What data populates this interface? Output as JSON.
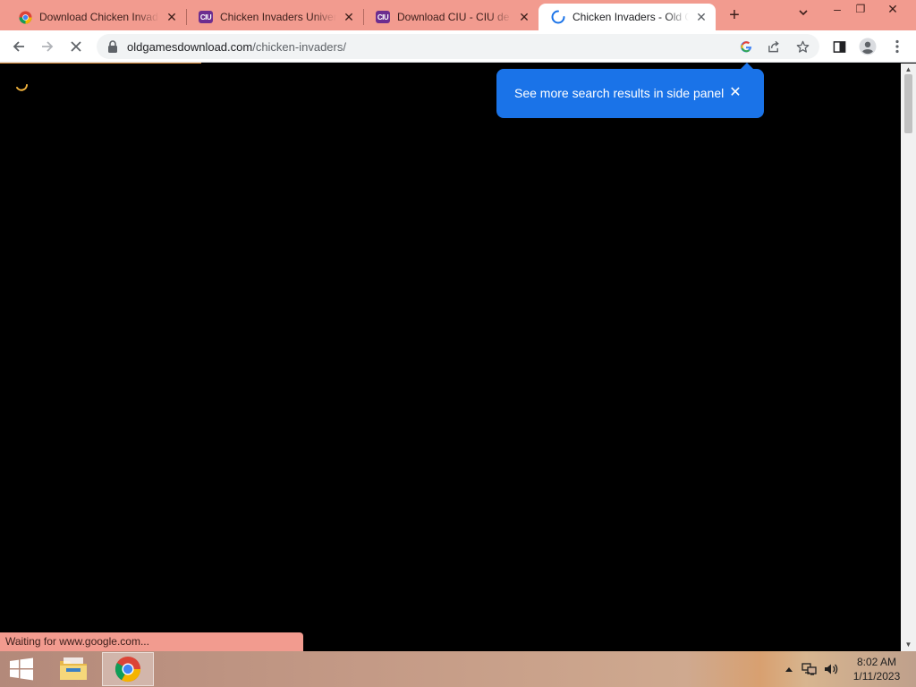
{
  "browser": {
    "tabs": [
      {
        "title": "Download Chicken Invaders",
        "favicon": "chrome-icon",
        "active": false
      },
      {
        "title": "Chicken Invaders Universe",
        "favicon": "ciu-icon",
        "active": false
      },
      {
        "title": "Download CIU - CIU de",
        "favicon": "ciu-icon",
        "active": false
      },
      {
        "title": "Chicken Invaders - Old G",
        "favicon": "loading-spinner-icon",
        "active": true
      }
    ],
    "tab_close_glyph": "✕",
    "new_tab_glyph": "+",
    "favicon_text": "CIU",
    "window_controls": {
      "minimize": "–",
      "restore": "❐",
      "close": "✕"
    },
    "address_bar": {
      "domain": "oldgamesdownload.com",
      "path": "/chicken-invaders/"
    },
    "load_progress_percent": 22,
    "colors": {
      "frame": "#f29b8f",
      "accent": "#1a73e8",
      "progress": "#f0a04b"
    }
  },
  "bubble": {
    "message": "See more search results in side panel",
    "close_glyph": "✕"
  },
  "status_bar": {
    "text": "Waiting for www.google.com..."
  },
  "taskbar": {
    "clock": {
      "time": "8:02 AM",
      "date": "1/11/2023"
    },
    "apps": [
      "file-explorer-icon",
      "chrome-icon"
    ],
    "tray": [
      "show-hidden-icons",
      "network-icon",
      "volume-icon"
    ]
  }
}
